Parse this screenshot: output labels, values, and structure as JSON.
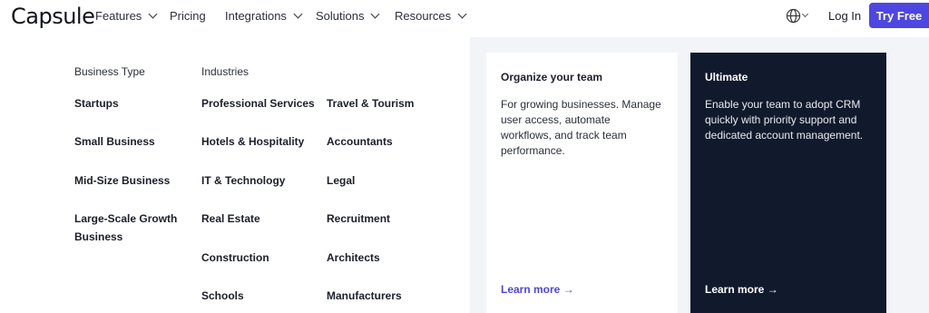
{
  "header": {
    "logo": "Capsule",
    "nav": [
      {
        "label": "Features",
        "dropdown": true
      },
      {
        "label": "Pricing",
        "dropdown": false
      },
      {
        "label": "Integrations",
        "dropdown": true
      },
      {
        "label": "Solutions",
        "dropdown": true
      },
      {
        "label": "Resources",
        "dropdown": true
      }
    ],
    "language_icon": "globe-icon",
    "login": "Log In",
    "cta": "Try Free"
  },
  "menu": {
    "business_type": {
      "heading": "Business Type",
      "items": [
        "Startups",
        "Small Business",
        "Mid-Size Business",
        "Large-Scale Growth Business"
      ]
    },
    "industries": {
      "heading": "Industries",
      "col1": [
        "Professional Services",
        "Hotels & Hospitality",
        "IT & Technology",
        "Real Estate",
        "Construction",
        "Schools"
      ],
      "col2": [
        "Travel & Tourism",
        "Accountants",
        "Legal",
        "Recruitment",
        "Architects",
        "Manufacturers"
      ]
    },
    "cards": [
      {
        "title": "Organize your team",
        "body": "For growing businesses. Manage user access, automate workflows, and track team performance.",
        "link": "Learn more →"
      },
      {
        "title": "Ultimate",
        "body": "Enable your team to adopt CRM quickly with priority support and dedicated account management.",
        "link": "Learn more →"
      }
    ]
  },
  "colors": {
    "accent": "#4d46e0",
    "dark_card": "#111a2c",
    "panel_bg": "#f3f4f8"
  }
}
